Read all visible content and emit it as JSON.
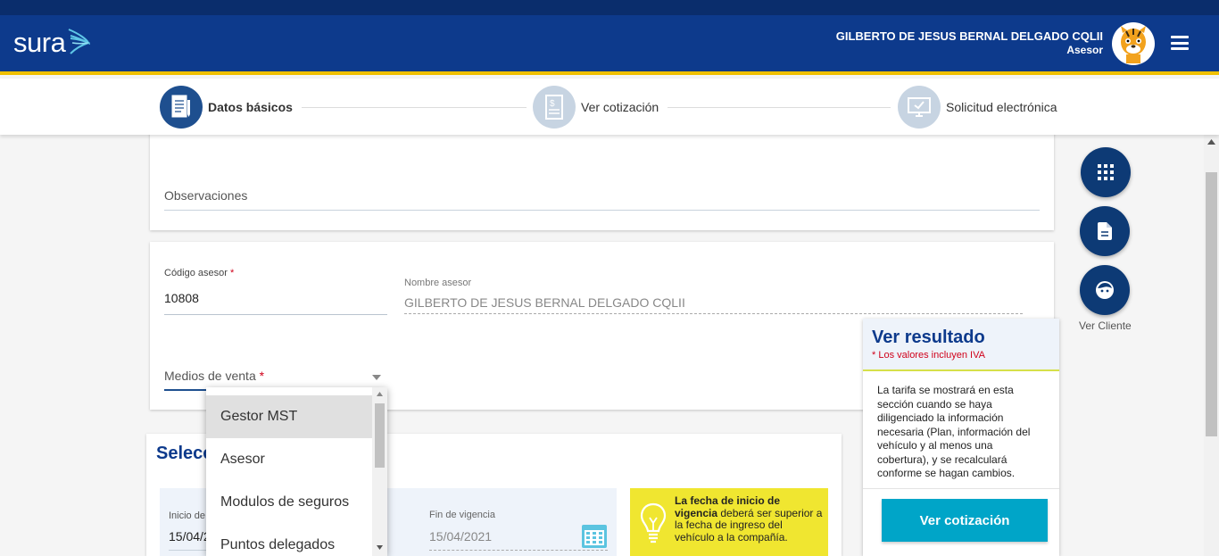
{
  "header": {
    "logo_text": "sura",
    "user_name": "GILBERTO DE JESUS BERNAL DELGADO CQLII",
    "user_role": "Asesor"
  },
  "steps": [
    {
      "label": "Datos básicos",
      "icon": "document-pen-icon",
      "active": true
    },
    {
      "label": "Ver cotización",
      "icon": "invoice-icon",
      "active": false
    },
    {
      "label": "Solicitud electrónica",
      "icon": "monitor-icon",
      "active": false
    }
  ],
  "form": {
    "observaciones_label": "Observaciones",
    "codigo_label": "Código asesor",
    "codigo_value": "10808",
    "nombre_label": "Nombre asesor",
    "nombre_value": "GILBERTO DE JESUS BERNAL DELGADO CQLII",
    "medios_label": "Medios de venta",
    "required_mark": "*"
  },
  "dropdown": {
    "options": [
      "Gestor MST",
      "Asesor",
      "Modulos de seguros",
      "Puntos delegados"
    ],
    "highlighted": "Gestor MST"
  },
  "vigencia": {
    "section_title_partial": "Selecc",
    "inicio_label": "Inicio de",
    "inicio_value": "15/04/2",
    "fin_label": "Fin de vigencia",
    "fin_value": "15/04/2021",
    "notice_bold": "La fecha de inicio de vigencia",
    "notice_rest": " deberá ser superior a la fecha de ingreso del vehículo a la compañía."
  },
  "side_actions": {
    "ver_cliente_label": "Ver Cliente",
    "icons": [
      "apps-grid-icon",
      "document-icon",
      "customer-face-icon"
    ]
  },
  "result": {
    "title": "Ver resultado",
    "note": "* Los valores incluyen IVA",
    "text": "La tarifa se mostrará en esta sección cuando se haya diligenciado la información necesaria (Plan, información del vehículo y al menos una cobertura), y se recalculará conforme se hagan cambios.",
    "button": "Ver cotización"
  },
  "colors": {
    "header": "#0d3a8c",
    "accent_yellow": "#f0c000",
    "button_cyan": "#00a5c8",
    "fab": "#0d3a75"
  }
}
